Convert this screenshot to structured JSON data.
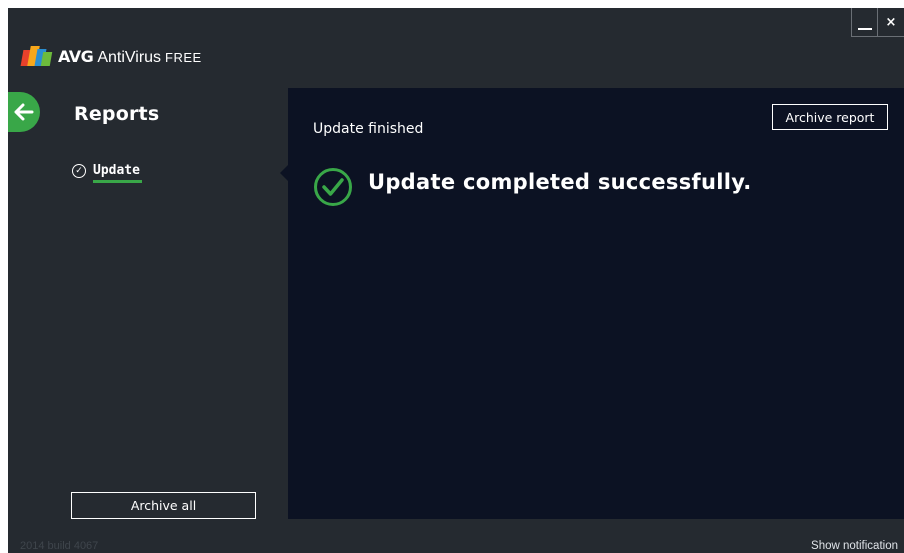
{
  "app": {
    "brand": "AVG",
    "product": "AntiVirus",
    "edition": "FREE"
  },
  "window_controls": {
    "minimize": "_",
    "close": "×"
  },
  "sidebar": {
    "back_icon": "arrow-left-icon",
    "title": "Reports",
    "items": [
      {
        "label": "Update",
        "icon": "check-circle-icon",
        "selected": true
      }
    ],
    "archive_all_label": "Archive all"
  },
  "report": {
    "title": "Update finished",
    "archive_label": "Archive report",
    "message": "Update completed successfully.",
    "status_icon": "success-check-icon"
  },
  "footer": {
    "version": "2014  build 4067",
    "notification_link": "Show notification"
  },
  "colors": {
    "accent_green": "#39a748",
    "panel_bg": "#0c1223",
    "window_bg": "#252a30"
  }
}
